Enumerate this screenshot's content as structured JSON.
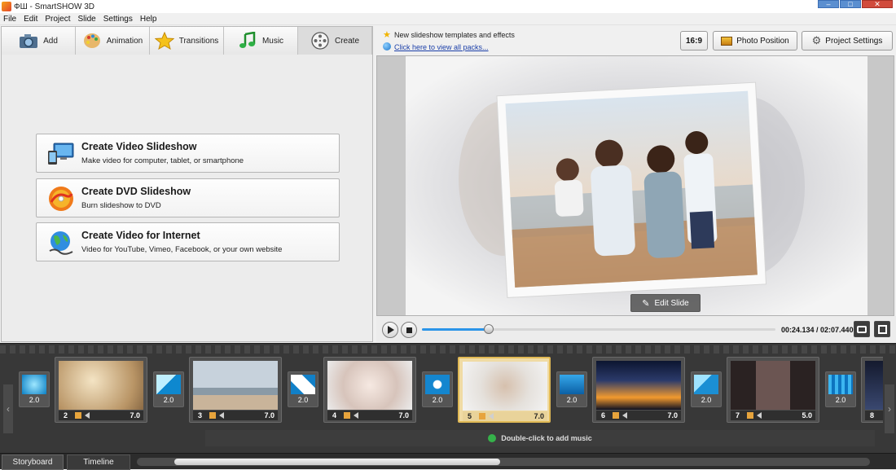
{
  "window": {
    "title": "ФШ - SmartSHOW 3D"
  },
  "menu": [
    "File",
    "Edit",
    "Project",
    "Slide",
    "Settings",
    "Help"
  ],
  "tabs": [
    {
      "label": "Add",
      "icon": "camera-icon"
    },
    {
      "label": "Animation",
      "icon": "palette-icon"
    },
    {
      "label": "Transitions",
      "icon": "star-icon"
    },
    {
      "label": "Music",
      "icon": "music-note-icon"
    },
    {
      "label": "Create",
      "icon": "film-reel-icon"
    }
  ],
  "create_options": [
    {
      "title": "Create Video Slideshow",
      "subtitle": "Make video for computer, tablet, or smartphone",
      "icon": "video-devices-icon"
    },
    {
      "title": "Create DVD Slideshow",
      "subtitle": "Burn slideshow to DVD",
      "icon": "dvd-disc-icon"
    },
    {
      "title": "Create Video for Internet",
      "subtitle": "Video for YouTube, Vimeo, Facebook, or your own website",
      "icon": "globe-icon"
    }
  ],
  "news": {
    "line1": "New slideshow templates and effects",
    "link": "Click here to view all packs..."
  },
  "toolbar": {
    "aspect": "16:9",
    "photo_position": "Photo Position",
    "project_settings": "Project Settings"
  },
  "preview": {
    "edit_slide": "Edit Slide"
  },
  "player": {
    "time": "00:24.134 / 02:07.440",
    "progress": 0.19
  },
  "storyboard": {
    "transitions": [
      "2.0",
      "2.0",
      "2.0",
      "2.0",
      "2.0",
      "2.0",
      "2.0"
    ],
    "slides": [
      {
        "num": "2",
        "duration": "7.0"
      },
      {
        "num": "3",
        "duration": "7.0"
      },
      {
        "num": "4",
        "duration": "7.0"
      },
      {
        "num": "5",
        "duration": "7.0",
        "selected": true
      },
      {
        "num": "6",
        "duration": "7.0"
      },
      {
        "num": "7",
        "duration": "5.0"
      },
      {
        "num": "8",
        "duration": ""
      }
    ],
    "music_hint": "Double-click to add music"
  },
  "bottom_tabs": {
    "storyboard": "Storyboard",
    "timeline": "Timeline"
  },
  "colors": {
    "accent": "#2b94e8",
    "selected_slide": "#f0dba4",
    "storyboard_bg": "#383838"
  }
}
